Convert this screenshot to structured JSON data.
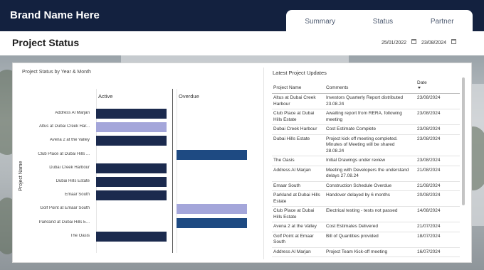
{
  "header": {
    "brand": "Brand Name Here",
    "tabs": [
      "Summary",
      "Status",
      "Partner"
    ]
  },
  "page": {
    "title": "Project Status",
    "date_from": "25/01/2022",
    "date_to": "23/08/2024"
  },
  "chart_data": {
    "type": "bar",
    "title": "Project Status by Year & Month",
    "ylabel": "Project Name",
    "panels": [
      "Active",
      "Overdue"
    ],
    "categories": [
      "Address Al Marjan",
      "Altus at Dubai Creek Har...",
      "Avena 2 at the Valley",
      "Club Place at Dubai Hills ...",
      "Dubai Creek Harbour",
      "Dubai Hills Estate",
      "Emaar South",
      "Golf Point at Emaar South",
      "Parkland at Dubai Hills E...",
      "The Oasis"
    ],
    "series": [
      {
        "panel": "Active",
        "values": [
          1,
          1,
          1,
          0,
          1,
          1,
          1,
          0,
          0,
          1
        ],
        "colors": [
          "#1b2a4e",
          "#a4a6da",
          "#1b2a4e",
          "",
          "#1b2a4e",
          "#1b2a4e",
          "#1b2a4e",
          "",
          "",
          "#1b2a4e"
        ]
      },
      {
        "panel": "Overdue",
        "values": [
          0,
          0,
          0,
          1,
          0,
          0,
          0,
          1,
          1,
          0
        ],
        "colors": [
          "",
          "",
          "",
          "#1e4a82",
          "",
          "",
          "",
          "#a4a6da",
          "#1e4a82",
          ""
        ]
      }
    ]
  },
  "table": {
    "title": "Latest Project Updates",
    "columns": [
      "Project Name",
      "Comments",
      "Date"
    ],
    "rows": [
      [
        "Altus at Dubai Creek Harbour",
        "Investors Quarterly Report distributed 23.08.24",
        "23/08/2024"
      ],
      [
        "Club Place at Dubai Hills Estate",
        "Awaiting report from RERA, following meeting",
        "23/08/2024"
      ],
      [
        "Dubai Creek Harbour",
        "Cost Estimate Complete",
        "23/08/2024"
      ],
      [
        "Dubai Hills Estate",
        "Project kick off meeting completed. Minutes of Meeting will be shared 28.08.24",
        "23/08/2024"
      ],
      [
        "The Oasis",
        "Initial Drawings under review",
        "23/08/2024"
      ],
      [
        "Address Al Marjan",
        "Meeting with Developers the understand delays 27.08.24",
        "21/08/2024"
      ],
      [
        "Emaar South",
        "Construction Schedule Overdue",
        "21/08/2024"
      ],
      [
        "Parkland at Dubai Hills Estate",
        "Handover delayed by 6 months",
        "20/08/2024"
      ],
      [
        "Club Place at Dubai Hills Estate",
        "Electrical testing - tests not passed",
        "14/08/2024"
      ],
      [
        "Avena 2 at the Valley",
        "Cost Estimates Delivered",
        "21/07/2024"
      ],
      [
        "Golf Point at Emaar South",
        "Bill of Quantities provided",
        "18/07/2024"
      ],
      [
        "Address Al Marjan",
        "Project Team Kick-off meeting",
        "16/07/2024"
      ]
    ]
  },
  "colors": {
    "header_bg": "#13213f",
    "bar_dark": "#1b2a4e",
    "bar_blue": "#1e4a82",
    "bar_light": "#a4a6da"
  }
}
